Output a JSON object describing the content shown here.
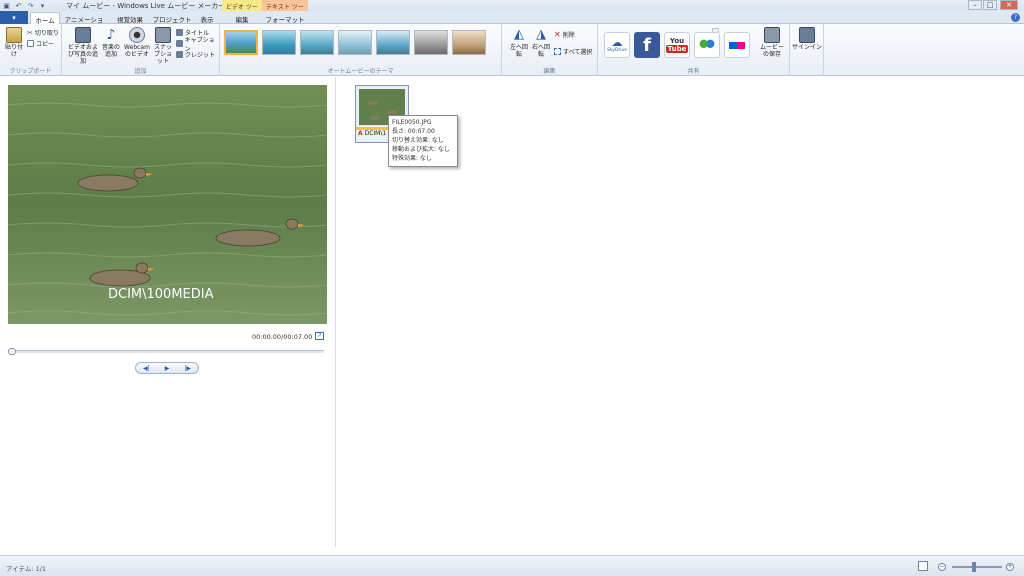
{
  "window": {
    "title": "マイ ムービー - Windows Live ムービー メーカー",
    "context_tab_video": "ビデオ ツール",
    "context_tab_text": "テキスト ツール",
    "minimize": "–",
    "maximize": "□",
    "close": "✕"
  },
  "quick_access": {
    "save": "▣",
    "undo": "↶",
    "redo": "↷",
    "more": "▾"
  },
  "tabs": [
    {
      "label": "ホーム"
    },
    {
      "label": "アニメーション"
    },
    {
      "label": "視覚効果"
    },
    {
      "label": "プロジェクト"
    },
    {
      "label": "表示"
    },
    {
      "label": "編集"
    },
    {
      "label": "フォーマット"
    }
  ],
  "file_button": "▾",
  "help": "?",
  "ribbon": {
    "clipboard": {
      "label": "クリップボード",
      "paste": "貼り付け",
      "cut": "切り取り",
      "copy": "コピー"
    },
    "add": {
      "label": "追加",
      "add_video_photo": "ビデオおよび写真の追加",
      "add_music": "音楽の追加",
      "webcam": "Webcam のビデオ",
      "snapshot": "スナップショット",
      "title": "タイトル",
      "caption": "キャプション",
      "credits": "クレジット"
    },
    "themes": {
      "label": "オートムービーのテーマ"
    },
    "edit": {
      "label": "編集",
      "rotate_left": "左へ回転",
      "rotate_right": "右へ回転",
      "delete": "削除",
      "select_all": "すべて選択"
    },
    "share": {
      "label": "共有",
      "skydrive": "SkyDrive",
      "facebook": "f",
      "youtube_top": "You",
      "youtube_bottom": "Tube",
      "save_movie": "ムービーの保存"
    },
    "signin": {
      "label": "サインイン"
    }
  },
  "preview": {
    "caption": "DCIM\\100MEDIA",
    "timecode": "00:00.00/00:07.00",
    "prev_frame": "◀|",
    "play": "▶",
    "next_frame": "|▶"
  },
  "storyboard": {
    "clip_caption_prefix": "A",
    "clip_caption": "DCIM\\1",
    "tooltip": {
      "filename": "FILE0050.JPG",
      "length": "長さ: 00:07.00",
      "transition": "切り替え効果: なし",
      "pan_zoom": "移動および拡大: なし",
      "effects": "特殊効果: なし"
    }
  },
  "status": {
    "items": "アイテム: 1/1",
    "zoom_out": "−",
    "zoom_in": "+"
  },
  "colors": {
    "accent": "#2a5ea8",
    "facebook": "#3b5998",
    "youtube": "#cc2a1e",
    "selected_theme": "#f0b440"
  }
}
